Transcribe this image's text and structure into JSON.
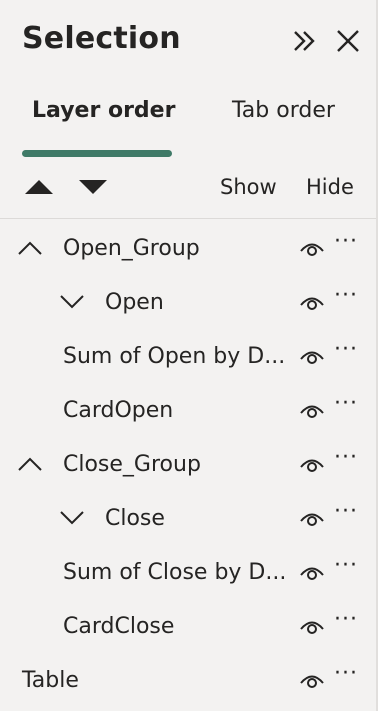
{
  "panel": {
    "title": "Selection",
    "expand_icon": "double-chevron-right-icon",
    "close_icon": "close-icon"
  },
  "tabs": [
    {
      "label": "Layer order",
      "active": true
    },
    {
      "label": "Tab order",
      "active": false
    }
  ],
  "toolbar": {
    "move_up_icon": "triangle-up-icon",
    "move_down_icon": "triangle-down-icon",
    "show_label": "Show",
    "hide_label": "Hide"
  },
  "items": [
    {
      "label": "Open_Group",
      "chevron": "up"
    },
    {
      "label": "Open",
      "chevron": "down"
    },
    {
      "label": "Sum of Open by D..."
    },
    {
      "label": "CardOpen"
    },
    {
      "label": "Close_Group",
      "chevron": "up"
    },
    {
      "label": "Close",
      "chevron": "down"
    },
    {
      "label": "Sum of Close by D..."
    },
    {
      "label": "CardClose"
    },
    {
      "label": "Table"
    }
  ],
  "row_actions": {
    "visibility_icon": "eye-icon",
    "more_label": "···"
  },
  "colors": {
    "accent": "#3f7a67",
    "background": "#f3f2f1",
    "text": "#252423"
  }
}
